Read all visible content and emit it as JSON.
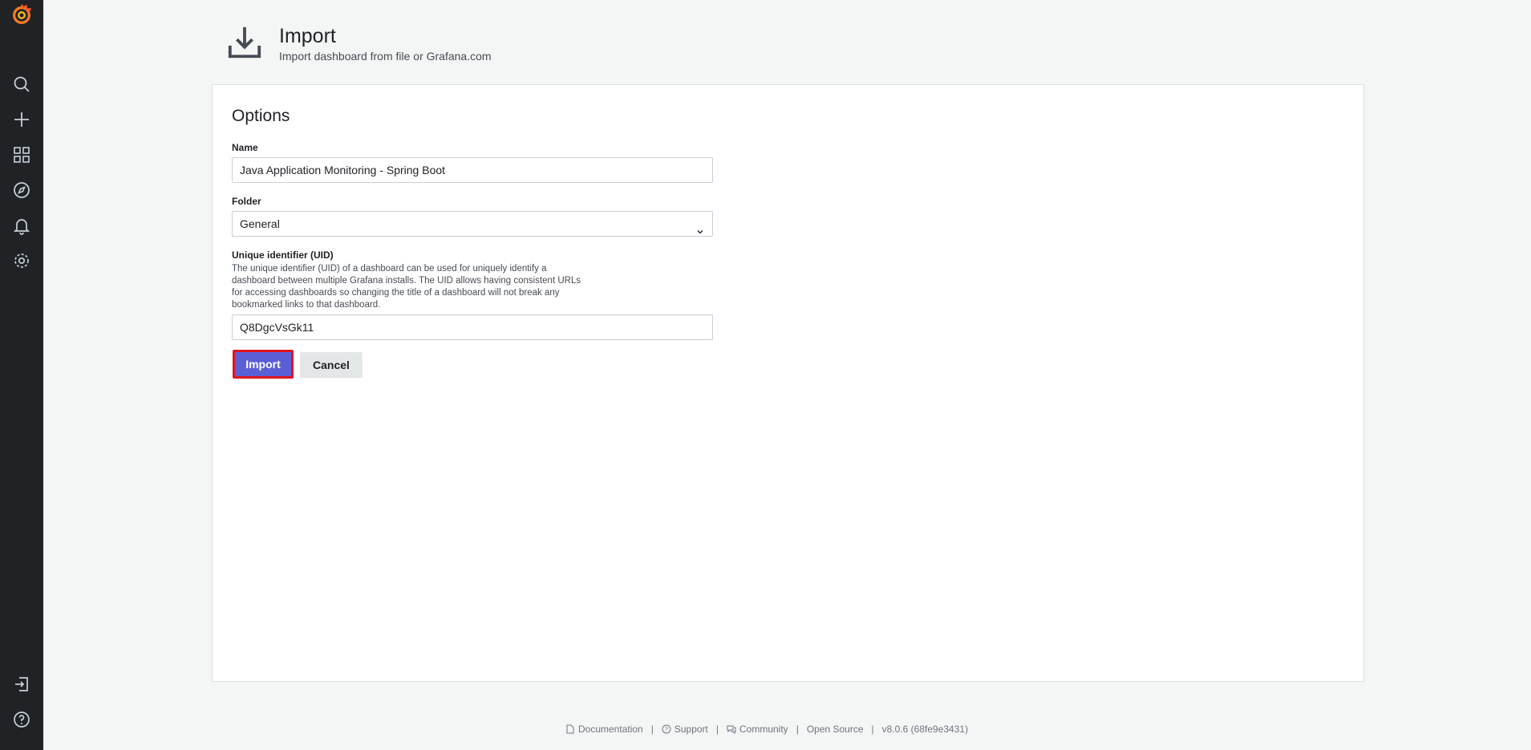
{
  "sidebar": {
    "logo": "grafana-logo",
    "items": [
      {
        "name": "search-icon"
      },
      {
        "name": "plus-icon"
      },
      {
        "name": "dashboards-icon"
      },
      {
        "name": "explore-icon"
      },
      {
        "name": "alerting-bell-icon"
      },
      {
        "name": "configuration-gear-icon"
      }
    ],
    "bottom": [
      {
        "name": "sign-in-icon"
      },
      {
        "name": "help-icon"
      }
    ]
  },
  "header": {
    "title": "Import",
    "subtitle": "Import dashboard from file or Grafana.com",
    "icon": "download-icon"
  },
  "options": {
    "title": "Options",
    "name_label": "Name",
    "name_value": "Java Application Monitoring - Spring Boot",
    "folder_label": "Folder",
    "folder_value": "General",
    "uid_label": "Unique identifier (UID)",
    "uid_desc_1": "The unique identifier (UID) of a dashboard can be used for uniquely identify a",
    "uid_desc_2": "dashboard between multiple Grafana installs. The UID allows having consistent URLs",
    "uid_desc_3": "for accessing dashboards so changing the title of a dashboard will not break any",
    "uid_desc_4": "bookmarked links to that dashboard.",
    "uid_value": "Q8DgcVsGk11",
    "import_label": "Import",
    "cancel_label": "Cancel"
  },
  "footer": {
    "documentation": "Documentation",
    "support": "Support",
    "community": "Community",
    "open_source": "Open Source",
    "version": "v8.0.6 (68fe9e3431)",
    "separator": "|"
  },
  "colors": {
    "sidebar_bg": "#202226",
    "primary_button": "#5b5fd6",
    "highlight_border": "#e0141e"
  }
}
